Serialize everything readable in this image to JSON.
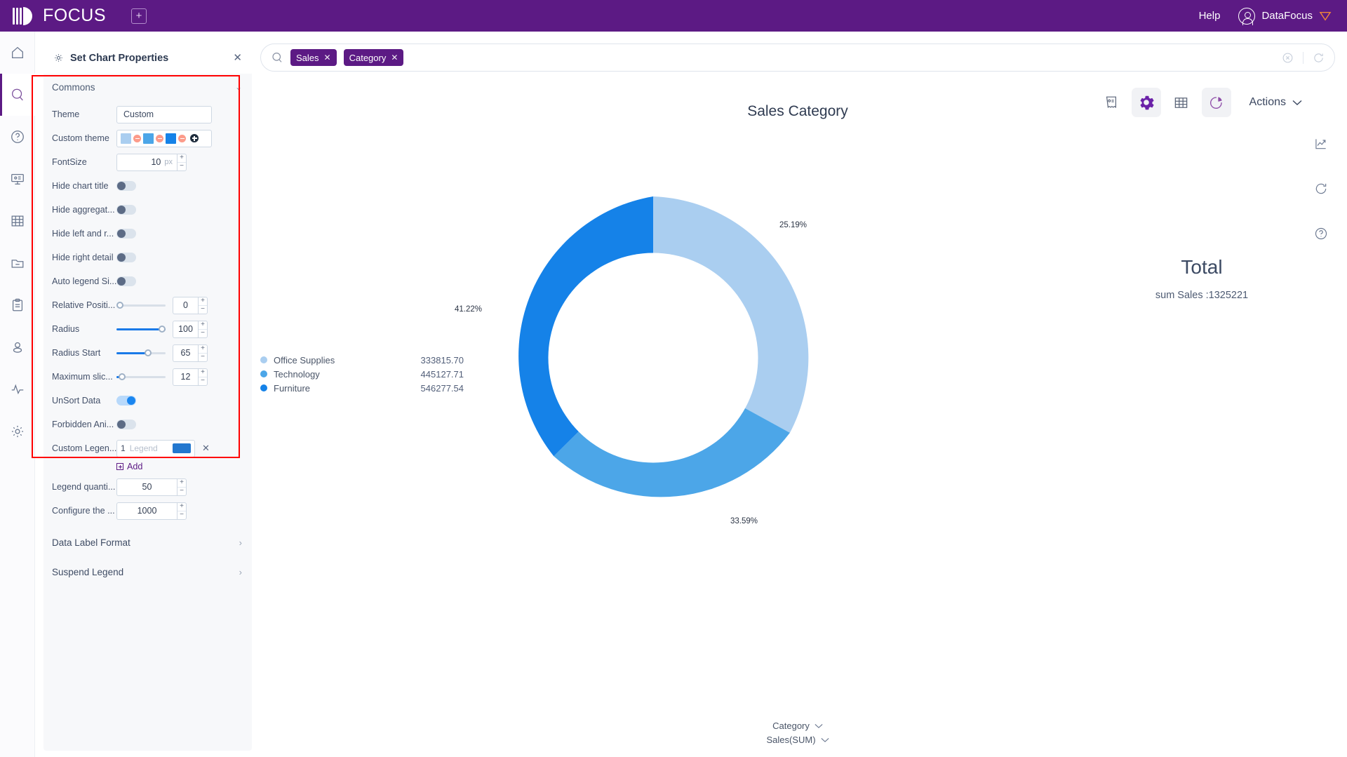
{
  "topbar": {
    "brand": "FOCUS",
    "new_tab_icon": "plus-square-icon",
    "help": "Help",
    "user": "DataFocus"
  },
  "rail": {
    "items": [
      {
        "icon": "home-icon",
        "active": false
      },
      {
        "icon": "search-icon",
        "active": true
      },
      {
        "icon": "question-circle-icon",
        "active": false
      },
      {
        "icon": "presentation-icon",
        "active": false
      },
      {
        "icon": "table-grid-icon",
        "active": false
      },
      {
        "icon": "folder-minus-icon",
        "active": false
      },
      {
        "icon": "clipboard-icon",
        "active": false
      },
      {
        "icon": "user-icon",
        "active": false
      },
      {
        "icon": "pulse-icon",
        "active": false
      },
      {
        "icon": "gear-icon",
        "active": false
      }
    ]
  },
  "panel": {
    "title": "Set Chart Properties",
    "gear_icon": "gear-icon",
    "close_icon": "close-icon",
    "section": {
      "label": "Commons",
      "chevron": "chevron-down-icon"
    },
    "props": {
      "theme": {
        "label": "Theme",
        "value": "Custom"
      },
      "custom_theme": {
        "label": "Custom theme",
        "colors": [
          "#aacef0",
          "#4ca6e8",
          "#1582e8"
        ],
        "remove_icon": "minus-circle-icon",
        "add_icon": "plus-circle-icon"
      },
      "font_size": {
        "label": "FontSize",
        "value": "10",
        "unit": "px"
      },
      "hide_chart_title": {
        "label": "Hide chart title",
        "on": false
      },
      "hide_aggregate": {
        "label": "Hide aggregat...",
        "on": false
      },
      "hide_left_right": {
        "label": "Hide left and r...",
        "on": false
      },
      "hide_right_detail": {
        "label": "Hide right detail",
        "on": false
      },
      "auto_legend_size": {
        "label": "Auto legend Si...",
        "on": false
      },
      "relative_position": {
        "label": "Relative Positi...",
        "value": "0",
        "percent": 0
      },
      "radius": {
        "label": "Radius",
        "value": "100",
        "percent": 100
      },
      "radius_start": {
        "label": "Radius Start",
        "value": "65",
        "percent": 65
      },
      "maximum_slice": {
        "label": "Maximum slic...",
        "value": "12",
        "percent": 6
      },
      "unsort_data": {
        "label": "UnSort Data",
        "on": true
      },
      "forbidden_animation": {
        "label": "Forbidden Ani...",
        "on": false
      },
      "custom_legend": {
        "label": "Custom Legen...",
        "index": "1",
        "placeholder": "Legend",
        "color": "#2277cf",
        "remove_icon": "close-icon",
        "add_label": "Add"
      },
      "legend_quantity": {
        "label": "Legend quanti...",
        "value": "50"
      },
      "configure_the": {
        "label": "Configure the ...",
        "value": "1000"
      }
    },
    "bottom_sections": [
      {
        "label": "Data Label Format",
        "arrow": "chevron-right-icon"
      },
      {
        "label": "Suspend Legend",
        "arrow": "chevron-right-icon"
      }
    ]
  },
  "search": {
    "icon": "search-icon",
    "tags": [
      "Sales",
      "Category"
    ],
    "clear_icon": "clear-circle-icon",
    "refresh_icon": "refresh-icon"
  },
  "toolbar": {
    "buttons": [
      {
        "icon": "receipt-icon",
        "selected": false
      },
      {
        "icon": "gear-icon",
        "selected": true
      },
      {
        "icon": "table-grid-icon",
        "selected": false
      },
      {
        "icon": "pie-chart-icon",
        "selected": true
      }
    ],
    "actions_label": "Actions",
    "actions_chevron": "chevron-down-icon"
  },
  "right_rail": {
    "icons": [
      "trend-chart-icon",
      "refresh-icon",
      "question-circle-icon"
    ]
  },
  "total": {
    "title": "Total",
    "subtitle": "sum Sales :1325221",
    "help_icon": "question-circle-icon"
  },
  "axis": {
    "category": "Category",
    "measure": "Sales(SUM)",
    "chevron": "chevron-down-icon"
  },
  "chart_data": {
    "type": "pie",
    "title": "Sales Category",
    "categories": [
      "Office Supplies",
      "Technology",
      "Furniture"
    ],
    "values": [
      333815.7,
      445127.71,
      546277.54
    ],
    "value_labels": [
      "333815.70",
      "445127.71",
      "546277.54"
    ],
    "percents": [
      25.19,
      33.59,
      41.22
    ],
    "percent_labels": [
      "25.19%",
      "33.59%",
      "41.22%"
    ],
    "colors": [
      "#aacef0",
      "#4ca6e8",
      "#1582e8"
    ],
    "donut": true,
    "inner_radius_pct": 65,
    "total": 1325221,
    "legend_position": "left",
    "xlabel": "Category",
    "ylabel": "Sales(SUM)"
  }
}
